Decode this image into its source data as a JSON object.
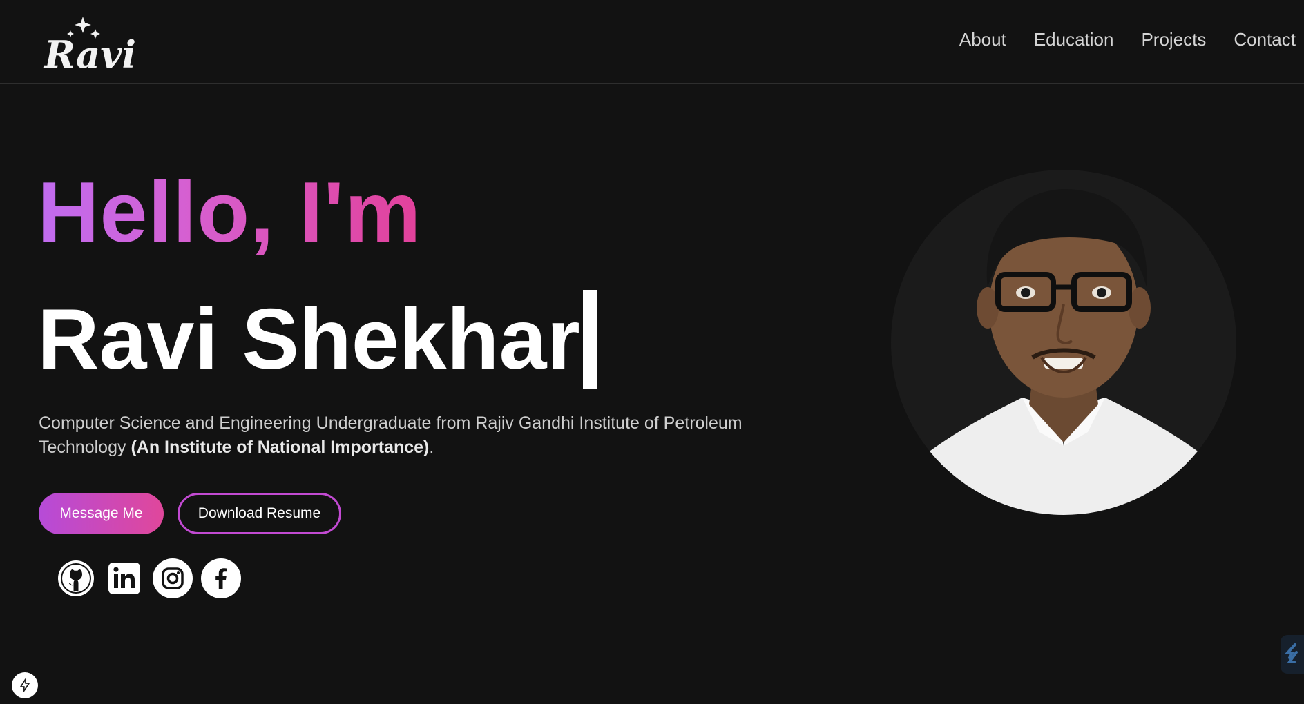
{
  "logo": {
    "text": "Ravi"
  },
  "nav": {
    "links": [
      "About",
      "Education",
      "Projects",
      "Contact"
    ]
  },
  "hero": {
    "greeting": "Hello, I'm",
    "name": "Ravi Shekhar",
    "description": "Computer Science and Engineering Undergraduate from Rajiv Gandhi Institute of Petroleum Technology ",
    "description_bold": "(An Institute of National Importance)",
    "description_end": ".",
    "primary_button": "Message Me",
    "secondary_button": "Download Resume"
  },
  "social": [
    {
      "icon": "github-icon"
    },
    {
      "icon": "linkedin-icon"
    },
    {
      "icon": "instagram-icon"
    },
    {
      "icon": "facebook-icon"
    }
  ],
  "colors": {
    "background": "#121212",
    "gradient_start": "#c06cf0",
    "gradient_end": "#e2419a",
    "text_white": "#ffffff"
  }
}
